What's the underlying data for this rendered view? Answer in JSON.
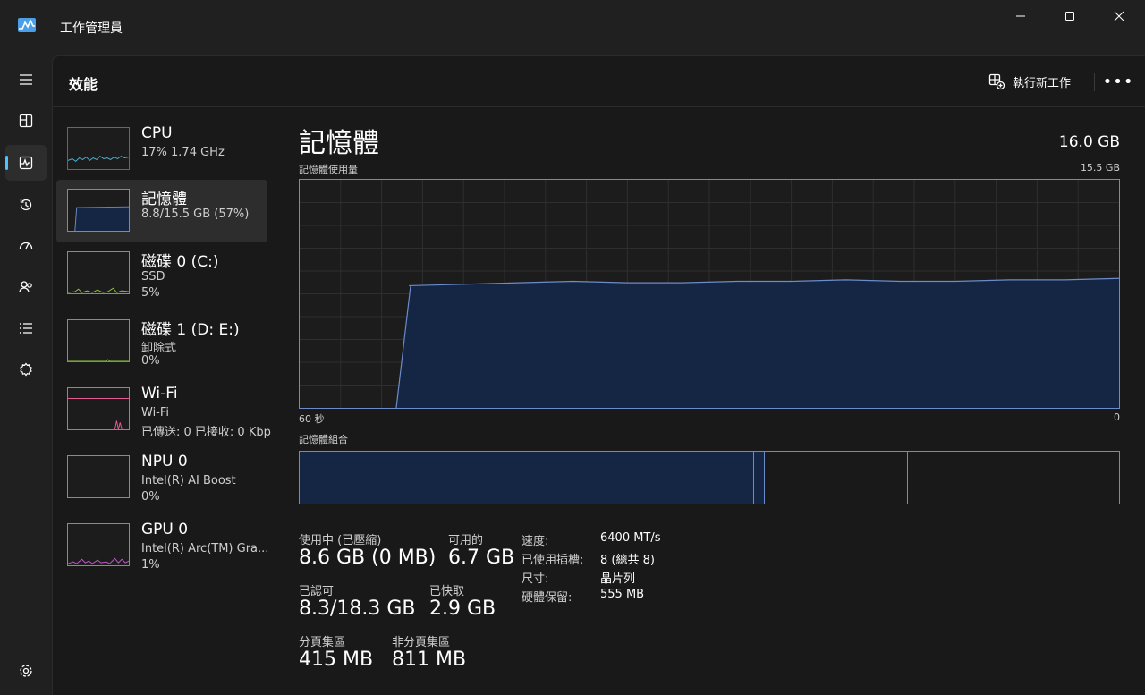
{
  "window": {
    "title": "工作管理員"
  },
  "colors": {
    "accent": "#4cc2ff",
    "graph_line": "#6b8bc9",
    "graph_fill": "#142644",
    "wifi": "#e35b8f",
    "gpu": "#c05ac9",
    "disk": "#8cc63f",
    "cpu": "#4fb3d9"
  },
  "nav": {
    "items": [
      {
        "icon": "hamburger-menu-icon"
      },
      {
        "icon": "processes-icon"
      },
      {
        "icon": "performance-icon"
      },
      {
        "icon": "app-history-icon"
      },
      {
        "icon": "startup-apps-icon"
      },
      {
        "icon": "users-icon"
      },
      {
        "icon": "details-icon"
      },
      {
        "icon": "services-icon"
      },
      {
        "icon": "settings-icon"
      }
    ]
  },
  "header": {
    "title": "效能",
    "run_task_label": "執行新工作",
    "more_label": "•••"
  },
  "resources": [
    {
      "name": "CPU",
      "line1": "17%  1.74 GHz",
      "line2": ""
    },
    {
      "name": "記憶體",
      "line1": "8.8/15.5 GB (57%)",
      "line2": ""
    },
    {
      "name": "磁碟 0 (C:)",
      "line1": "SSD",
      "line2": "5%"
    },
    {
      "name": "磁碟 1 (D: E:)",
      "line1": "卸除式",
      "line2": "0%"
    },
    {
      "name": "Wi-Fi",
      "line1": "Wi-Fi",
      "line2": "已傳送: 0 已接收: 0 Kbps"
    },
    {
      "name": "NPU 0",
      "line1": "Intel(R) AI Boost",
      "line2": "0%"
    },
    {
      "name": "GPU 0",
      "line1": "Intel(R) Arc(TM) Gra...",
      "line2": "1%"
    }
  ],
  "detail": {
    "title": "記憶體",
    "total": "16.0 GB",
    "usage_label": "記憶體使用量",
    "usage_max": "15.5 GB",
    "axis_left": "60 秒",
    "axis_right": "0",
    "composition_label": "記憶體組合",
    "stats": {
      "in_use_label": "使用中 (已壓縮)",
      "in_use_value": "8.6 GB (0 MB)",
      "available_label": "可用的",
      "available_value": "6.7 GB",
      "committed_label": "已認可",
      "committed_value": "8.3/18.3 GB",
      "cached_label": "已快取",
      "cached_value": "2.9 GB",
      "paged_label": "分頁集區",
      "paged_value": "415 MB",
      "nonpaged_label": "非分頁集區",
      "nonpaged_value": "811 MB"
    },
    "properties": [
      {
        "key": "速度:",
        "value": "6400 MT/s"
      },
      {
        "key": "已使用插槽:",
        "value": "8 (總共 8)"
      },
      {
        "key": "尺寸:",
        "value": "晶片列"
      },
      {
        "key": "硬體保留:",
        "value": "555 MB"
      }
    ]
  },
  "chart_data": {
    "type": "area",
    "title": "記憶體使用量",
    "xlabel": "",
    "ylabel": "",
    "x_range_seconds": [
      60,
      0
    ],
    "ylim": [
      0,
      15.5
    ],
    "unit": "GB",
    "x": [
      60,
      56,
      52,
      48,
      44,
      40,
      36,
      32,
      28,
      24,
      20,
      16,
      12,
      8,
      4,
      0
    ],
    "values": [
      0,
      8.3,
      8.3,
      8.4,
      8.5,
      8.6,
      8.5,
      8.5,
      8.6,
      8.6,
      8.7,
      8.6,
      8.6,
      8.7,
      8.7,
      8.8
    ],
    "composition": {
      "in_use_gb": 8.6,
      "modified_gb": 0.2,
      "standby_gb": 2.7,
      "free_gb": 4.0
    },
    "grid": true
  }
}
